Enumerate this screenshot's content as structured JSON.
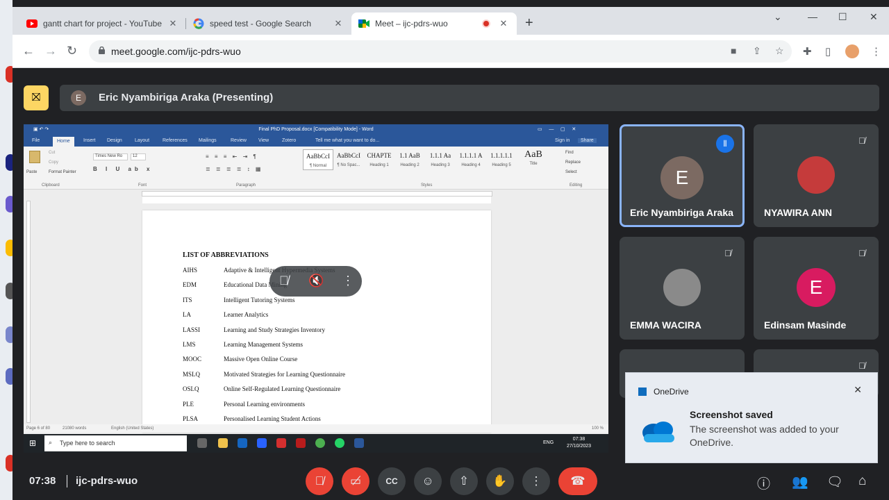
{
  "browser": {
    "tabs": [
      {
        "title": "gantt chart for project - YouTube",
        "icon": "youtube-icon"
      },
      {
        "title": "speed test - Google Search",
        "icon": "google-icon"
      },
      {
        "title": "Meet – ijc-pdrs-wuo",
        "icon": "meet-icon",
        "recording": true
      }
    ],
    "url": "meet.google.com/ijc-pdrs-wuo"
  },
  "meet": {
    "presenter_initial": "E",
    "presenter_label": "Eric Nyambiriga Araka (Presenting)",
    "time": "07:38",
    "meeting_code": "ijc-pdrs-wuo",
    "participants": [
      {
        "name": "Eric Nyambiriga Araka",
        "initial": "E",
        "color": "#7c6a62",
        "speaking": true
      },
      {
        "name": "NYAWIRA ANN",
        "initial": "",
        "color": "#c53b3b"
      },
      {
        "name": "EMMA WACIRA",
        "initial": "",
        "color": "#8a8a8a"
      },
      {
        "name": "Edinsam Masinde",
        "initial": "E",
        "color": "#d81b60"
      }
    ]
  },
  "shared_screen": {
    "window_title": "Final PhD Proposal.docx [Compatibility Mode] - Word",
    "ribbon_tabs": [
      "File",
      "Home",
      "Insert",
      "Design",
      "Layout",
      "References",
      "Mailings",
      "Review",
      "View",
      "Zotero"
    ],
    "tell_me": "Tell me what you want to do...",
    "sign_in": "Sign in",
    "share": "Share",
    "font_name": "Times New Ro",
    "font_size": "12",
    "groups": [
      "Clipboard",
      "Font",
      "Paragraph",
      "Styles",
      "Editing"
    ],
    "clipboard_items": [
      "Paste",
      "Cut",
      "Copy",
      "Format Painter"
    ],
    "editing_items": [
      "Find",
      "Replace",
      "Select"
    ],
    "styles": [
      {
        "sample": "AaBbCcI",
        "name": "¶ Normal"
      },
      {
        "sample": "AaBbCcI",
        "name": "¶ No Spac..."
      },
      {
        "sample": "CHAPTE",
        "name": "Heading 1"
      },
      {
        "sample": "1.1 AaB",
        "name": "Heading 2"
      },
      {
        "sample": "1.1.1 Aa",
        "name": "Heading 3"
      },
      {
        "sample": "1.1.1.1 A",
        "name": "Heading 4"
      },
      {
        "sample": "1.1.1.1.1",
        "name": "Heading 5"
      },
      {
        "sample": "AaB",
        "name": "Title"
      }
    ],
    "doc_heading": "LIST OF ABBREVIATIONS",
    "abbreviations": [
      {
        "abbr": "AIHS",
        "def": "Adaptive & Intelligent Hypermedia Systems"
      },
      {
        "abbr": "EDM",
        "def": "Educational Data Mining"
      },
      {
        "abbr": "ITS",
        "def": "Intelligent Tutoring Systems"
      },
      {
        "abbr": "LA",
        "def": "Learner Analytics"
      },
      {
        "abbr": "LASSI",
        "def": "Learning and Study Strategies Inventory"
      },
      {
        "abbr": "LMS",
        "def": "Learning Management Systems"
      },
      {
        "abbr": "MOOC",
        "def": "Massive Open Online Course"
      },
      {
        "abbr": "MSLQ",
        "def": "Motivated Strategies for Learning Questionnaire"
      },
      {
        "abbr": "OSLQ",
        "def": "Online Self-Regulated Learning Questionnaire"
      },
      {
        "abbr": "PLE",
        "def": "Personal Learning environments"
      },
      {
        "abbr": "PLSA",
        "def": "Personalised Learning Student Actions"
      }
    ],
    "status_page": "Page 6 of 80",
    "status_words": "21080 words",
    "status_lang": "English (United States)",
    "status_zoom": "100 %",
    "taskbar_search": "Type here to search",
    "taskbar_lang": "ENG",
    "taskbar_time": "07:38",
    "taskbar_date": "27/10/2023"
  },
  "toast": {
    "app": "OneDrive",
    "title": "Screenshot saved",
    "body": "The screenshot was added to your OneDrive."
  }
}
